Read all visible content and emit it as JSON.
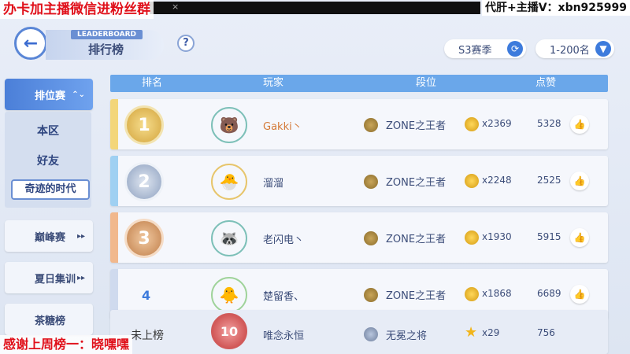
{
  "overlays": {
    "top_left": "办卡加主播微信进粉丝群",
    "top_right": "代肝+主播V：xbn925999",
    "bottom_left": "感谢上周榜一：晓嘿嘿",
    "window_close": "×"
  },
  "header": {
    "back_icon": "back-arrow-icon",
    "back_glyph": "←",
    "title_en": "LEADERBOARD",
    "title": "排行榜",
    "help": "?",
    "season": "S3赛季",
    "season_glyph": "⟳",
    "range": "1-200名",
    "range_glyph": "▼"
  },
  "sidebar": {
    "items": [
      {
        "label": "排位赛",
        "arrow": "⌃⌄"
      },
      {
        "label": "巅峰赛",
        "arrow": "▸▸"
      },
      {
        "label": "夏日集训",
        "arrow": "▸▸"
      },
      {
        "label": "茶糖榜",
        "arrow": ""
      }
    ],
    "sub_items": [
      "本区",
      "好友",
      "奇迹的时代"
    ]
  },
  "table": {
    "headers": [
      "排名",
      "玩家",
      "段位",
      "点赞"
    ],
    "rows": [
      {
        "rank": "1",
        "name": "Gakki丶",
        "tier": "ZONE之王者",
        "coins": "x2369",
        "likes": "5328",
        "medal": "gold"
      },
      {
        "rank": "2",
        "name": "溜溜",
        "tier": "ZONE之王者",
        "coins": "x2248",
        "likes": "2525",
        "medal": "silver"
      },
      {
        "rank": "3",
        "name": "老闪电丶",
        "tier": "ZONE之王者",
        "coins": "x1930",
        "likes": "5915",
        "medal": "bronze"
      },
      {
        "rank": "4",
        "name": "楚留香、",
        "tier": "ZONE之王者",
        "coins": "x1868",
        "likes": "6689",
        "medal": "none"
      },
      {
        "rank": "未上榜",
        "name": "唯念永恒",
        "tier": "无冕之将",
        "coins": "x29",
        "likes": "756",
        "medal": "none",
        "avatar_badge": "10"
      }
    ],
    "like_glyph": "👍"
  },
  "colors": {
    "accent": "#3d7bdc",
    "header_bar": "#6aa7ea",
    "gold": "#e7c56b",
    "silver": "#a9b7cf",
    "bronze": "#d99a6a"
  }
}
